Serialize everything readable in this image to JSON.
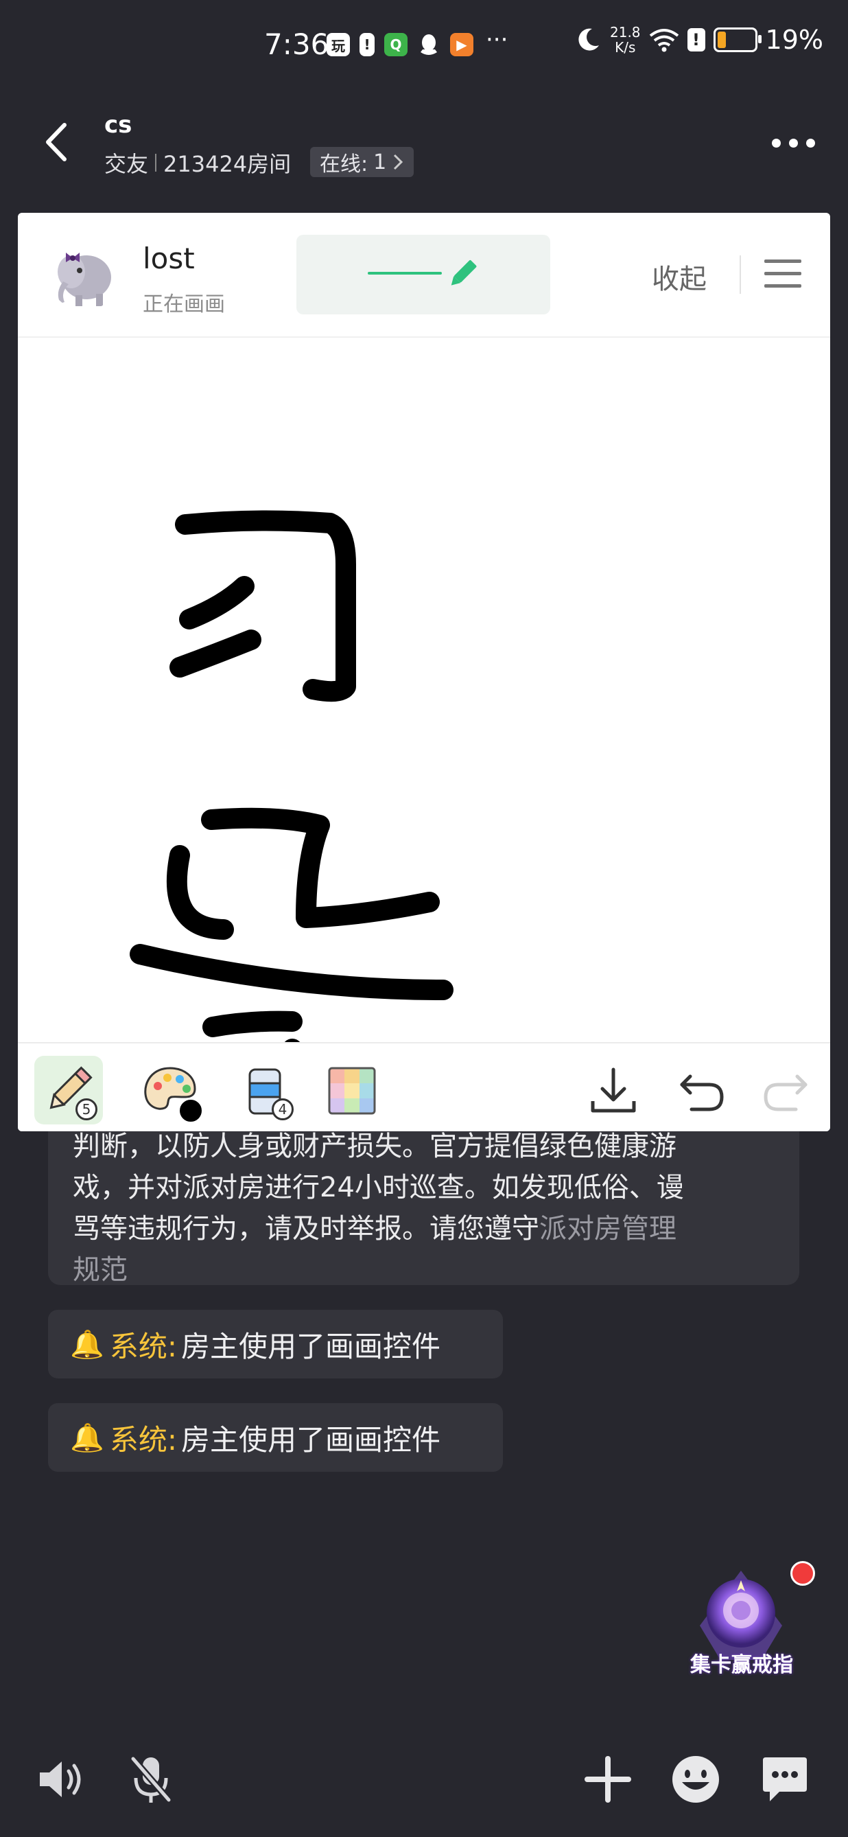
{
  "status_bar": {
    "time": "7:36",
    "apps": [
      "玩",
      "!",
      "Q",
      "▶"
    ],
    "more": "···",
    "net_speed_top": "21.8",
    "net_speed_bottom": "K/s",
    "battery_percent": "19%"
  },
  "header": {
    "title": "cs",
    "category": "交友",
    "room": "213424房间",
    "online_label": "在线:",
    "online_count": "1"
  },
  "draw_panel": {
    "drawer_name": "lost",
    "drawer_status": "正在画画",
    "collapse_label": "收起",
    "brush_color": "#2ec27e",
    "pencil_count": "5",
    "palette_color": "#000000",
    "eraser_count": "4"
  },
  "chat": {
    "notice_line1": "判断，以防人身或财产损失。官方提倡绿色健康游",
    "notice_line2": "戏，并对派对房进行24小时巡查。如发现低俗、谩",
    "notice_line3": "骂等违规行为，请及时举报。请您遵守",
    "notice_link_a": "派对房管理",
    "notice_link_b": "规范",
    "messages": [
      {
        "label": "系统:",
        "text": "房主使用了画画控件"
      },
      {
        "label": "系统:",
        "text": "房主使用了画画控件"
      }
    ]
  },
  "promo": {
    "text": "集卡赢戒指"
  },
  "colors": {
    "background": "#27272e",
    "bubble": "#34343b",
    "system_yellow": "#f7c43b",
    "notification_red": "#f03b3b"
  }
}
